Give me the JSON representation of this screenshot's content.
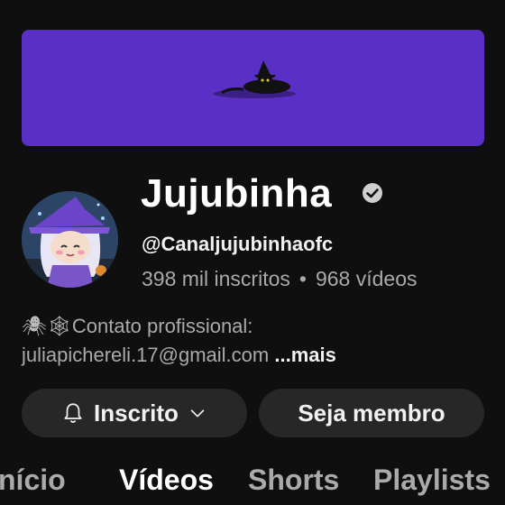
{
  "channel": {
    "name": "Jujubinha",
    "handle": "@Canaljujubinhaofc",
    "subscribers": "398 mil inscritos",
    "separator": "•",
    "videos": "968 vídeos"
  },
  "description": {
    "emoji": "🕷🕸",
    "line1": "Contato profissional:",
    "email": "juliapichereli.17@gmail.com",
    "more": "...mais"
  },
  "buttons": {
    "subscribed": "Inscrito",
    "member": "Seja membro"
  },
  "tabs": [
    {
      "label": "nício"
    },
    {
      "label": "Vídeos"
    },
    {
      "label": "Shorts"
    },
    {
      "label": "Playlists"
    }
  ],
  "colors": {
    "background": "#0f0f0f",
    "banner": "#5a2fc6",
    "button_bg": "#272727",
    "secondary_text": "#aaaaaa"
  },
  "icons": [
    "verified-icon",
    "bell-icon",
    "chevron-down-icon",
    "spider-icon",
    "spider-web-icon"
  ]
}
